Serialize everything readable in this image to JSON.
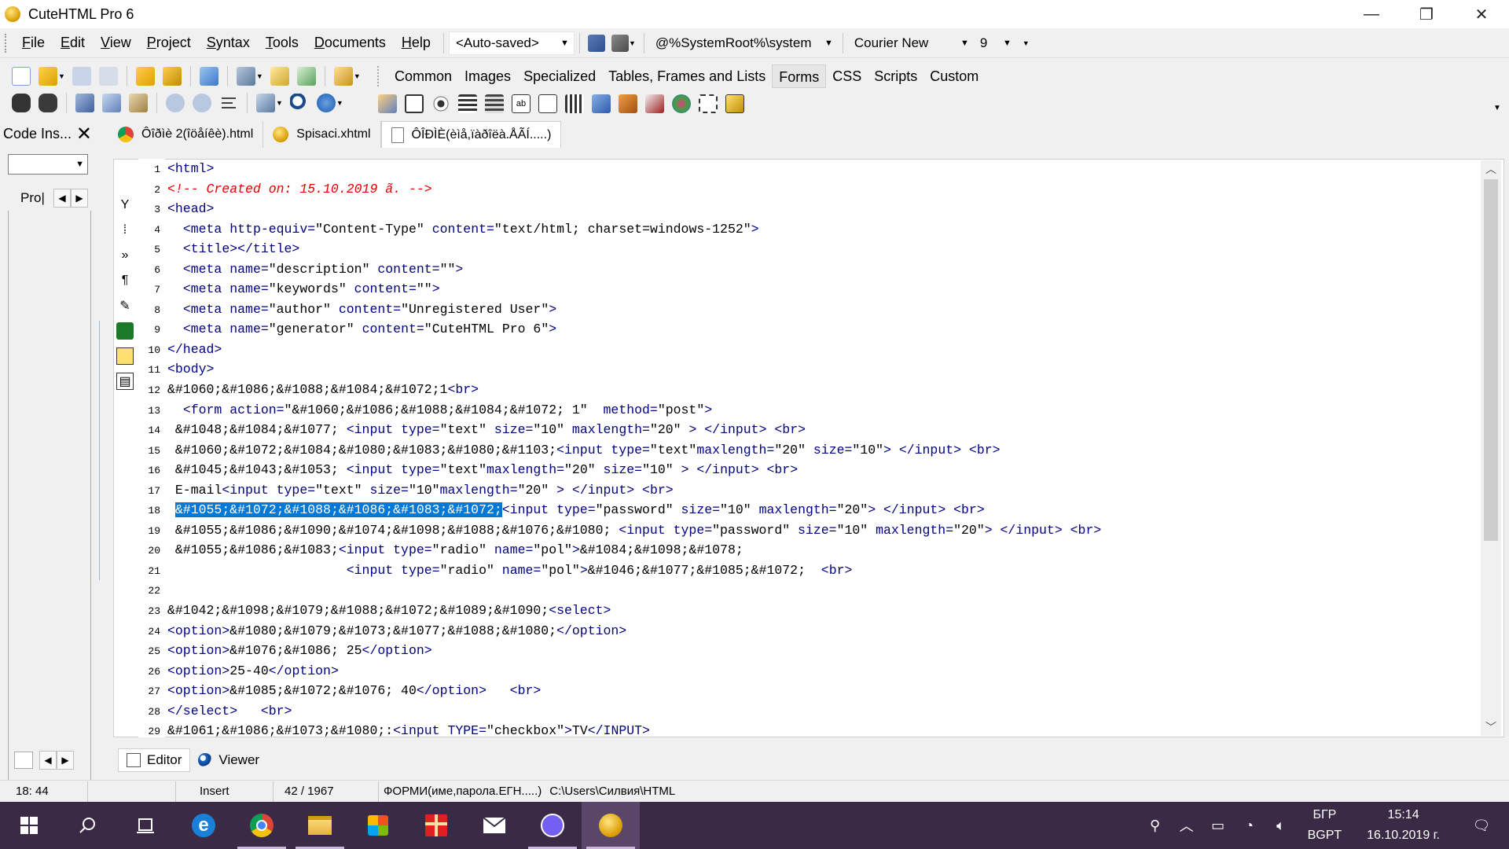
{
  "window": {
    "title": "CuteHTML Pro 6",
    "minimize": "—",
    "restore": "❐",
    "close": "✕"
  },
  "menu": [
    {
      "label": "File",
      "u": "F",
      "rest": "ile"
    },
    {
      "label": "Edit",
      "u": "E",
      "rest": "dit"
    },
    {
      "label": "View",
      "u": "V",
      "rest": "iew"
    },
    {
      "label": "Project",
      "u": "P",
      "rest": "roject"
    },
    {
      "label": "Syntax",
      "u": "S",
      "rest": "yntax"
    },
    {
      "label": "Tools",
      "u": "T",
      "rest": "ools"
    },
    {
      "label": "Documents",
      "u": "D",
      "rest": "ocuments"
    },
    {
      "label": "Help",
      "u": "H",
      "rest": "elp"
    }
  ],
  "toolbar": {
    "autosaved": "<Auto-saved>",
    "system_path": "@%SystemRoot%\\system",
    "font_name": "Courier New",
    "font_size": "9"
  },
  "tag_tabs": [
    "Common",
    "Images",
    "Specialized",
    "Tables, Frames and Lists",
    "Forms",
    "CSS",
    "Scripts",
    "Custom"
  ],
  "tag_tabs_active": "Forms",
  "left_panel": {
    "title": "Code Ins...",
    "close": "✕",
    "tab_label": "Pro|",
    "combo_value": ""
  },
  "doc_tabs": [
    {
      "label": "Ôîðìè 2(îöåíêè).html",
      "icon": "chrome-icon"
    },
    {
      "label": "Spisaci.xhtml",
      "icon": "cutehtml-icon"
    },
    {
      "label": "ÔÎÐÌÈ(èìå,ïàðîëà.ÅÃÍ.....)",
      "icon": "document-icon"
    }
  ],
  "code_lines": [
    [
      {
        "t": "tag",
        "s": "<html>"
      }
    ],
    [
      {
        "t": "cmt",
        "s": "<!-- Created on: 15.10.2019 ã. -->"
      }
    ],
    [
      {
        "t": "tag",
        "s": "<head>"
      }
    ],
    [
      {
        "t": "txt",
        "s": "  "
      },
      {
        "t": "tag",
        "s": "<meta "
      },
      {
        "t": "attr",
        "s": "http-equiv="
      },
      {
        "t": "val",
        "s": "\"Content-Type\" "
      },
      {
        "t": "attr",
        "s": "content="
      },
      {
        "t": "val",
        "s": "\"text/html; charset=windows-1252\""
      },
      {
        "t": "tag",
        "s": ">"
      }
    ],
    [
      {
        "t": "txt",
        "s": "  "
      },
      {
        "t": "tag",
        "s": "<title></title>"
      }
    ],
    [
      {
        "t": "txt",
        "s": "  "
      },
      {
        "t": "tag",
        "s": "<meta "
      },
      {
        "t": "attr",
        "s": "name="
      },
      {
        "t": "val",
        "s": "\"description\" "
      },
      {
        "t": "attr",
        "s": "content="
      },
      {
        "t": "val",
        "s": "\"\""
      },
      {
        "t": "tag",
        "s": ">"
      }
    ],
    [
      {
        "t": "txt",
        "s": "  "
      },
      {
        "t": "tag",
        "s": "<meta "
      },
      {
        "t": "attr",
        "s": "name="
      },
      {
        "t": "val",
        "s": "\"keywords\" "
      },
      {
        "t": "attr",
        "s": "content="
      },
      {
        "t": "val",
        "s": "\"\""
      },
      {
        "t": "tag",
        "s": ">"
      }
    ],
    [
      {
        "t": "txt",
        "s": "  "
      },
      {
        "t": "tag",
        "s": "<meta "
      },
      {
        "t": "attr",
        "s": "name="
      },
      {
        "t": "val",
        "s": "\"author\" "
      },
      {
        "t": "attr",
        "s": "content="
      },
      {
        "t": "val",
        "s": "\"Unregistered User\""
      },
      {
        "t": "tag",
        "s": ">"
      }
    ],
    [
      {
        "t": "txt",
        "s": "  "
      },
      {
        "t": "tag",
        "s": "<meta "
      },
      {
        "t": "attr",
        "s": "name="
      },
      {
        "t": "val",
        "s": "\"generator\" "
      },
      {
        "t": "attr",
        "s": "content="
      },
      {
        "t": "val",
        "s": "\"CuteHTML Pro 6\""
      },
      {
        "t": "tag",
        "s": ">"
      }
    ],
    [
      {
        "t": "tag",
        "s": "</head>"
      }
    ],
    [
      {
        "t": "tag",
        "s": "<body>"
      }
    ],
    [
      {
        "t": "ent",
        "s": "&#1060;&#1086;&#1088;&#1084;&#1072;1"
      },
      {
        "t": "tag",
        "s": "<br>"
      }
    ],
    [
      {
        "t": "txt",
        "s": "  "
      },
      {
        "t": "tag",
        "s": "<form "
      },
      {
        "t": "attr",
        "s": "action="
      },
      {
        "t": "val",
        "s": "\"&#1060;&#1086;&#1088;&#1084;&#1072; 1\"  "
      },
      {
        "t": "attr",
        "s": "method="
      },
      {
        "t": "val",
        "s": "\"post\""
      },
      {
        "t": "tag",
        "s": ">"
      }
    ],
    [
      {
        "t": "ent",
        "s": " &#1048;&#1084;&#1077; "
      },
      {
        "t": "tag",
        "s": "<input "
      },
      {
        "t": "attr",
        "s": "type="
      },
      {
        "t": "val",
        "s": "\"text\" "
      },
      {
        "t": "attr",
        "s": "size="
      },
      {
        "t": "val",
        "s": "\"10\" "
      },
      {
        "t": "attr",
        "s": "maxlength="
      },
      {
        "t": "val",
        "s": "\"20\" "
      },
      {
        "t": "tag",
        "s": "> </input> <br>"
      }
    ],
    [
      {
        "t": "ent",
        "s": " &#1060;&#1072;&#1084;&#1080;&#1083;&#1080;&#1103;"
      },
      {
        "t": "tag",
        "s": "<input "
      },
      {
        "t": "attr",
        "s": "type="
      },
      {
        "t": "val",
        "s": "\"text\""
      },
      {
        "t": "attr",
        "s": "maxlength="
      },
      {
        "t": "val",
        "s": "\"20\" "
      },
      {
        "t": "attr",
        "s": "size="
      },
      {
        "t": "val",
        "s": "\"10\""
      },
      {
        "t": "tag",
        "s": "> </input> <br>"
      }
    ],
    [
      {
        "t": "ent",
        "s": " &#1045;&#1043;&#1053; "
      },
      {
        "t": "tag",
        "s": "<input "
      },
      {
        "t": "attr",
        "s": "type="
      },
      {
        "t": "val",
        "s": "\"text\""
      },
      {
        "t": "attr",
        "s": "maxlength="
      },
      {
        "t": "val",
        "s": "\"20\" "
      },
      {
        "t": "attr",
        "s": "size="
      },
      {
        "t": "val",
        "s": "\"10\" "
      },
      {
        "t": "tag",
        "s": "> </input> <br>"
      }
    ],
    [
      {
        "t": "ent",
        "s": " E-mail"
      },
      {
        "t": "tag",
        "s": "<input "
      },
      {
        "t": "attr",
        "s": "type="
      },
      {
        "t": "val",
        "s": "\"text\" "
      },
      {
        "t": "attr",
        "s": "size="
      },
      {
        "t": "val",
        "s": "\"10\""
      },
      {
        "t": "attr",
        "s": "maxlength="
      },
      {
        "t": "val",
        "s": "\"20\" "
      },
      {
        "t": "tag",
        "s": "> </input> <br>"
      }
    ],
    [
      {
        "t": "txt",
        "s": " "
      },
      {
        "t": "sel",
        "s": "&#1055;&#1072;&#1088;&#1086;&#1083;&#1072;"
      },
      {
        "t": "tag",
        "s": "<input "
      },
      {
        "t": "attr",
        "s": "type="
      },
      {
        "t": "val",
        "s": "\"password\" "
      },
      {
        "t": "attr",
        "s": "size="
      },
      {
        "t": "val",
        "s": "\"10\" "
      },
      {
        "t": "attr",
        "s": "maxlength="
      },
      {
        "t": "val",
        "s": "\"20\""
      },
      {
        "t": "tag",
        "s": "> </input> <br>"
      }
    ],
    [
      {
        "t": "ent",
        "s": " &#1055;&#1086;&#1090;&#1074;&#1098;&#1088;&#1076;&#1080; "
      },
      {
        "t": "tag",
        "s": "<input "
      },
      {
        "t": "attr",
        "s": "type="
      },
      {
        "t": "val",
        "s": "\"password\" "
      },
      {
        "t": "attr",
        "s": "size="
      },
      {
        "t": "val",
        "s": "\"10\" "
      },
      {
        "t": "attr",
        "s": "maxlength="
      },
      {
        "t": "val",
        "s": "\"20\""
      },
      {
        "t": "tag",
        "s": "> </input> <br>"
      }
    ],
    [
      {
        "t": "ent",
        "s": " &#1055;&#1086;&#1083;"
      },
      {
        "t": "tag",
        "s": "<input "
      },
      {
        "t": "attr",
        "s": "type="
      },
      {
        "t": "val",
        "s": "\"radio\" "
      },
      {
        "t": "attr",
        "s": "name="
      },
      {
        "t": "val",
        "s": "\"pol\""
      },
      {
        "t": "tag",
        "s": ">"
      },
      {
        "t": "ent",
        "s": "&#1084;&#1098;&#1078;"
      }
    ],
    [
      {
        "t": "txt",
        "s": "                       "
      },
      {
        "t": "tag",
        "s": "<input "
      },
      {
        "t": "attr",
        "s": "type="
      },
      {
        "t": "val",
        "s": "\"radio\" "
      },
      {
        "t": "attr",
        "s": "name="
      },
      {
        "t": "val",
        "s": "\"pol\""
      },
      {
        "t": "tag",
        "s": ">"
      },
      {
        "t": "ent",
        "s": "&#1046;&#1077;&#1085;&#1072;  "
      },
      {
        "t": "tag",
        "s": "<br>"
      }
    ],
    [],
    [
      {
        "t": "ent",
        "s": "&#1042;&#1098;&#1079;&#1088;&#1072;&#1089;&#1090;"
      },
      {
        "t": "tag",
        "s": "<select>"
      }
    ],
    [
      {
        "t": "tag",
        "s": "<option>"
      },
      {
        "t": "ent",
        "s": "&#1080;&#1079;&#1073;&#1077;&#1088;&#1080;"
      },
      {
        "t": "tag",
        "s": "</option>"
      }
    ],
    [
      {
        "t": "tag",
        "s": "<option>"
      },
      {
        "t": "ent",
        "s": "&#1076;&#1086; 25"
      },
      {
        "t": "tag",
        "s": "</option>"
      }
    ],
    [
      {
        "t": "tag",
        "s": "<option>"
      },
      {
        "t": "ent",
        "s": "25-40"
      },
      {
        "t": "tag",
        "s": "</option>"
      }
    ],
    [
      {
        "t": "tag",
        "s": "<option>"
      },
      {
        "t": "ent",
        "s": "&#1085;&#1072;&#1076; 40"
      },
      {
        "t": "tag",
        "s": "</option>   <br>"
      }
    ],
    [
      {
        "t": "tag",
        "s": "</select>   <br>"
      }
    ],
    [
      {
        "t": "ent",
        "s": "&#1061;&#1086;&#1073;&#1080;:"
      },
      {
        "t": "tag",
        "s": "<input "
      },
      {
        "t": "attr",
        "s": "TYPE="
      },
      {
        "t": "val",
        "s": "\"checkbox\""
      },
      {
        "t": "tag",
        "s": ">"
      },
      {
        "t": "ent",
        "s": "TV"
      },
      {
        "t": "tag",
        "s": "</INPUT>"
      }
    ]
  ],
  "bottom_tabs": [
    {
      "label": "Editor",
      "icon": "editor-icon",
      "active": true
    },
    {
      "label": "Viewer",
      "icon": "viewer-icon",
      "active": false
    }
  ],
  "status": {
    "cursor": "18:  44",
    "mode": "Insert",
    "position": "42 /    1967",
    "file_name": "ФОРМИ(име,парола.ЕГН.....)",
    "path": "C:\\Users\\Силвия\\HTML"
  },
  "taskbar": {
    "apps": [
      "windows-start-icon",
      "search-icon",
      "task-view-icon",
      "edge-icon",
      "chrome-icon",
      "file-explorer-icon",
      "store-icon",
      "gift-icon",
      "mail-icon",
      "viber-icon",
      "cutehtml-icon"
    ],
    "lang_top": "БГР",
    "lang_bottom": "BGPT",
    "time": "15:14",
    "date": "16.10.2019 г."
  },
  "colors": {
    "tag": "#000080",
    "comment": "#e00000",
    "selection": "#0078d7",
    "taskbar": "#3a2a46"
  }
}
